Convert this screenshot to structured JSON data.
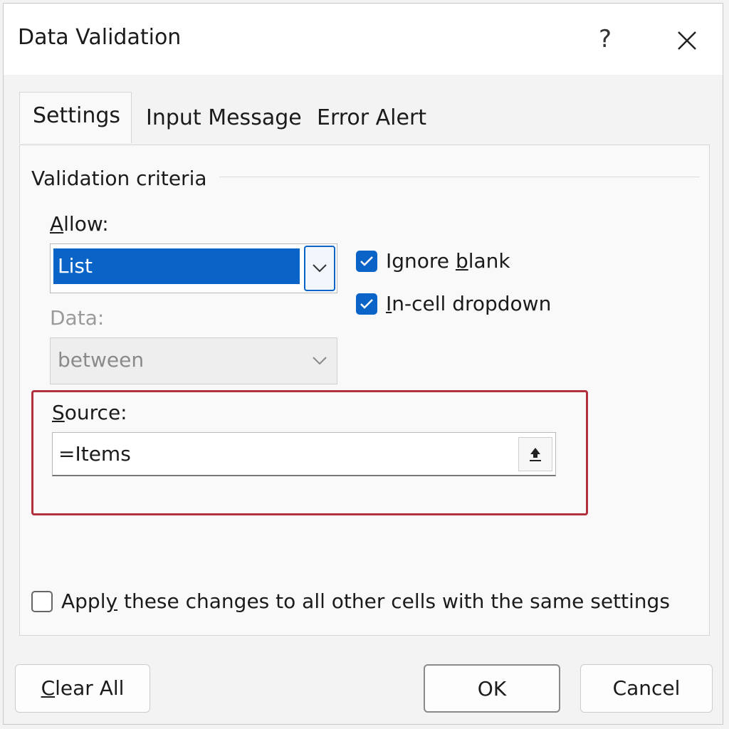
{
  "window": {
    "title": "Data Validation",
    "help": "?",
    "close": "✕"
  },
  "tabs": [
    {
      "label": "Settings",
      "active": true
    },
    {
      "label": "Input Message",
      "active": false
    },
    {
      "label": "Error Alert",
      "active": false
    }
  ],
  "criteria": {
    "group_label": "Validation criteria",
    "allow_label_u": "A",
    "allow_label_rest": "llow:",
    "allow_value": "List",
    "data_label": "Data:",
    "data_value": "between",
    "ignore_blank_pre": "Ignore ",
    "ignore_blank_u": "b",
    "ignore_blank_post": "lank",
    "ignore_blank_checked": true,
    "incell_u": "I",
    "incell_post": "n-cell dropdown",
    "incell_checked": true
  },
  "source": {
    "label_u": "S",
    "label_rest": "ource:",
    "value": "=Items"
  },
  "apply_all": {
    "label_pre": "Appl",
    "label_u": "y",
    "label_post": " these changes to all other cells with the same settings",
    "checked": false
  },
  "buttons": {
    "clear_all_u": "C",
    "clear_all_rest": "lear All",
    "ok": "OK",
    "cancel": "Cancel"
  },
  "colors": {
    "accent": "#0a64c8",
    "highlight_border": "#b0303b"
  }
}
